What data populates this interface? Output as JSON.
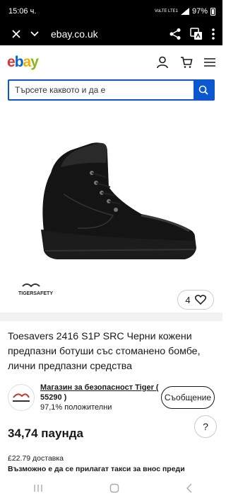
{
  "status": {
    "time": "15:06 ч.",
    "network": "VoLTE LTE1",
    "battery": "97%"
  },
  "browser": {
    "url": "ebay.co.uk"
  },
  "header": {
    "logo": {
      "e": "e",
      "b": "b",
      "a": "a",
      "y": "y"
    }
  },
  "search": {
    "placeholder": "Търсете каквото и да е"
  },
  "product": {
    "brand_mark": "TIGERSAFETY",
    "likes": "4",
    "title": "Toesavers 2416 S1P SRC Черни кожени предпазни ботуши със стоманено бомбе, лични предпазни средства"
  },
  "seller": {
    "name": "Магазин за безопасност Tiger (",
    "count": "55290 )",
    "feedback": "97,1% положителни",
    "message_label": "Съобщение"
  },
  "price": {
    "value": "34,74 паунда",
    "help": "?"
  },
  "shipping": {
    "cost": "£22.79 доставка",
    "fees": "Възможно е да се прилагат такси за внос преди"
  },
  "colors": {
    "accent": "#0b57d0",
    "text": "#191919"
  }
}
